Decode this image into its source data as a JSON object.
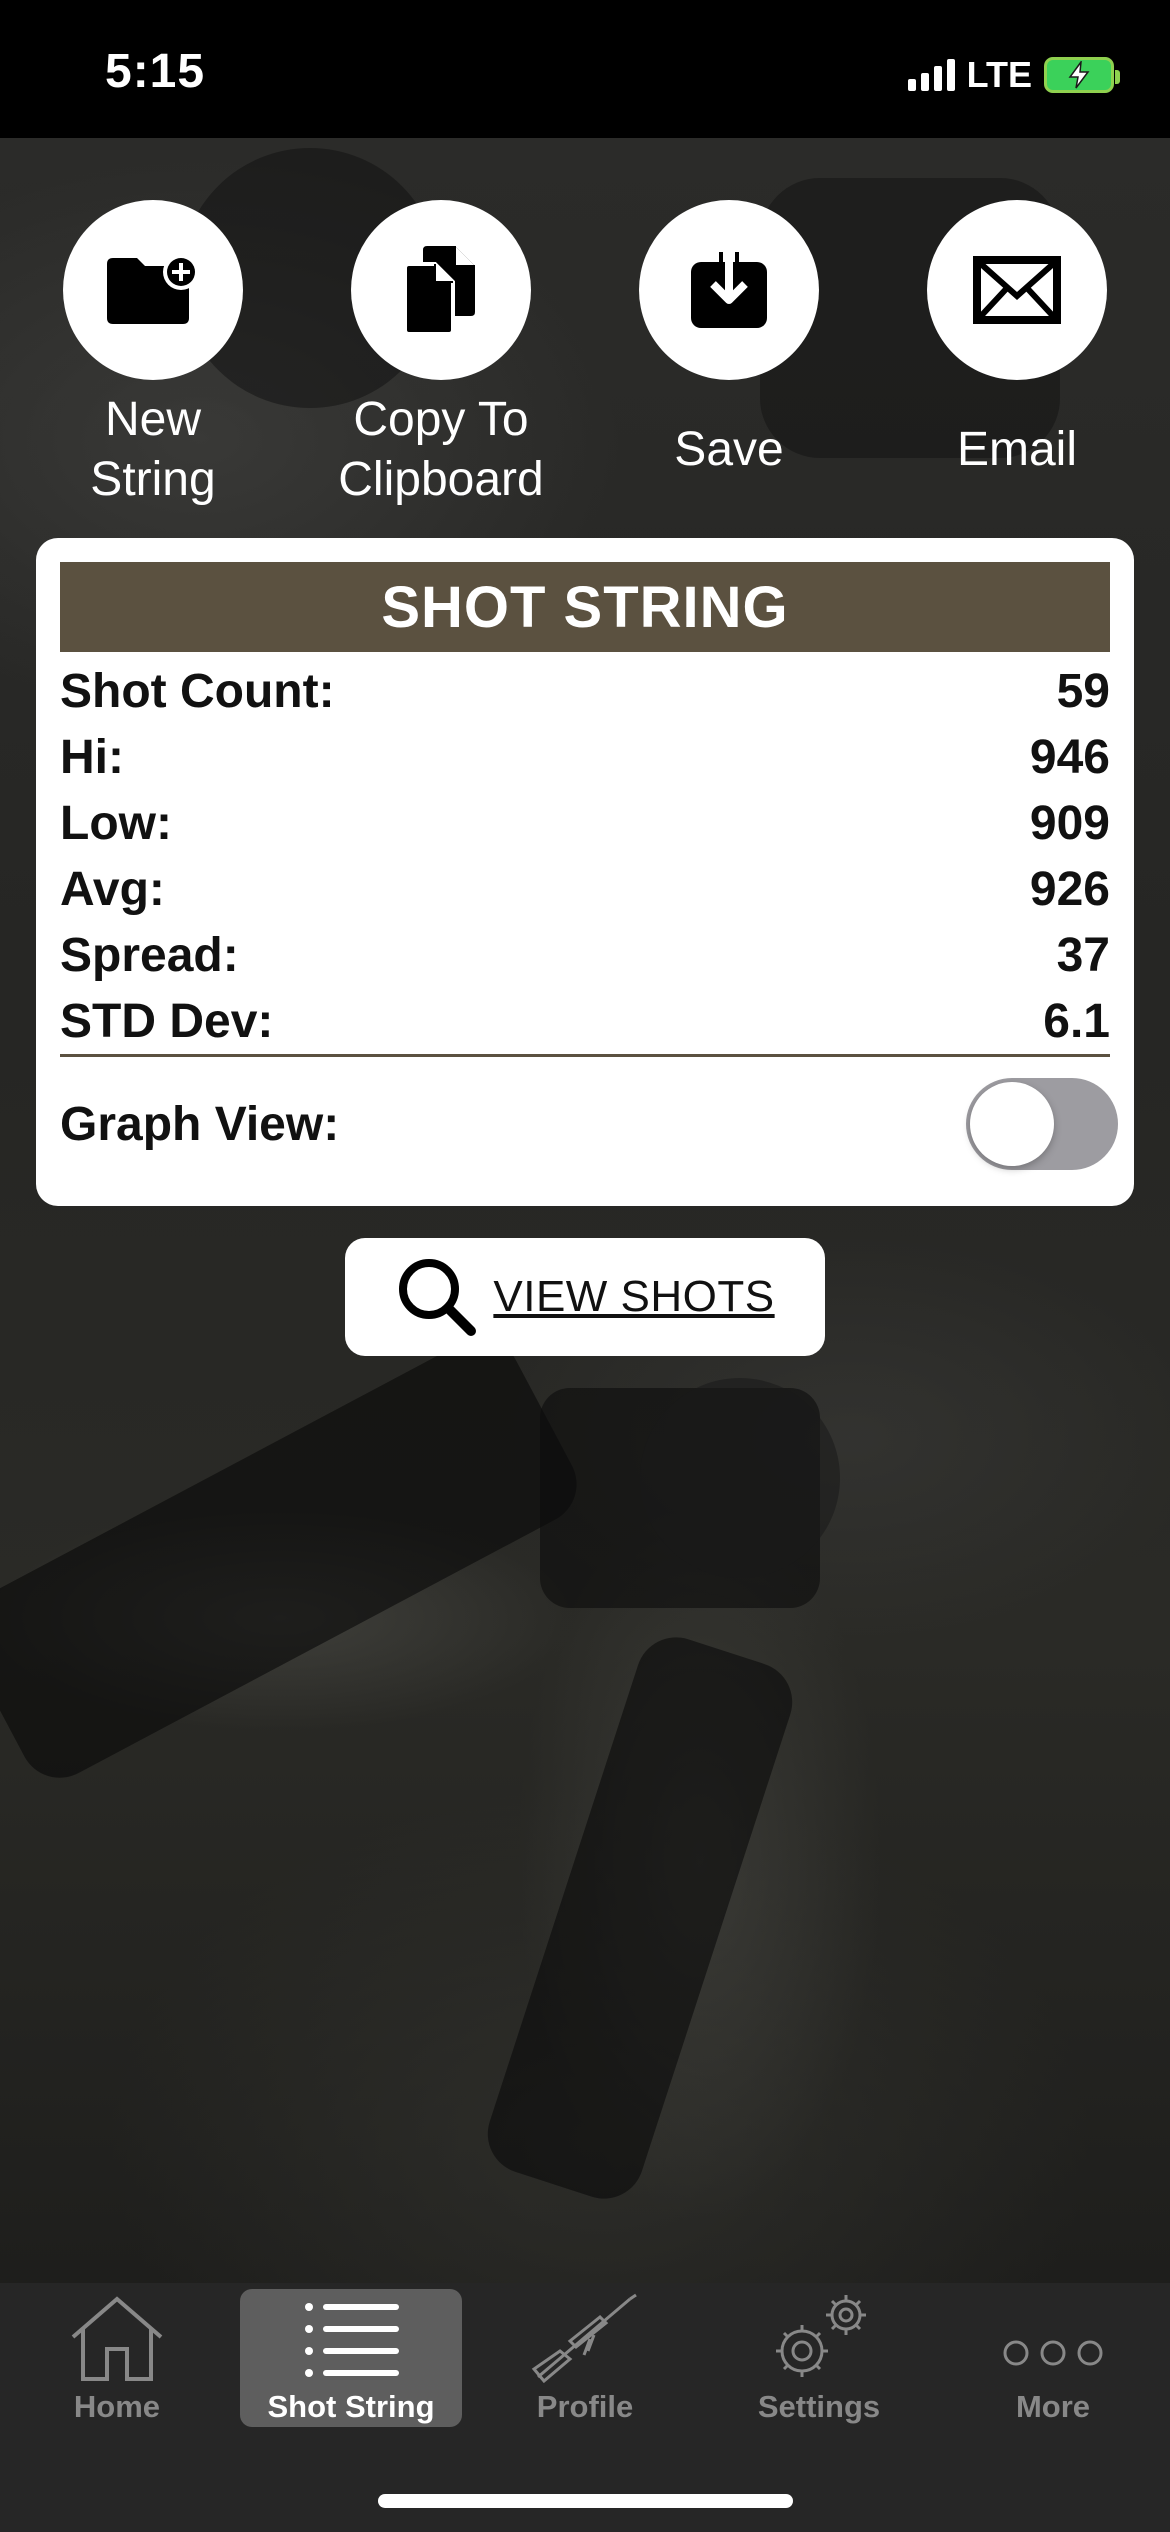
{
  "status_bar": {
    "time": "5:15",
    "network": "LTE"
  },
  "actions": [
    {
      "label": "New\nString",
      "icon": "folder-plus-icon"
    },
    {
      "label": "Copy To\nClipboard",
      "icon": "copy-icon"
    },
    {
      "label": "Save",
      "icon": "download-icon"
    },
    {
      "label": "Email",
      "icon": "envelope-icon"
    }
  ],
  "card": {
    "title": "SHOT STRING",
    "stats": [
      {
        "label": "Shot Count:",
        "value": "59"
      },
      {
        "label": "Hi:",
        "value": "946"
      },
      {
        "label": "Low:",
        "value": "909"
      },
      {
        "label": "Avg:",
        "value": "926"
      },
      {
        "label": "Spread:",
        "value": "37"
      },
      {
        "label": "STD Dev:",
        "value": "6.1"
      }
    ],
    "graph_view_label": "Graph View:",
    "graph_view_on": false
  },
  "view_shots_label": "VIEW SHOTS",
  "tabs": [
    {
      "label": "Home",
      "icon": "home-icon",
      "active": false
    },
    {
      "label": "Shot String",
      "icon": "list-icon",
      "active": true
    },
    {
      "label": "Profile",
      "icon": "rifle-icon",
      "active": false
    },
    {
      "label": "Settings",
      "icon": "gears-icon",
      "active": false
    },
    {
      "label": "More",
      "icon": "more-icon",
      "active": false
    }
  ],
  "colors": {
    "header_brown": "#5b5140",
    "tab_bar": "#262626",
    "battery_green": "#3bd15a"
  }
}
